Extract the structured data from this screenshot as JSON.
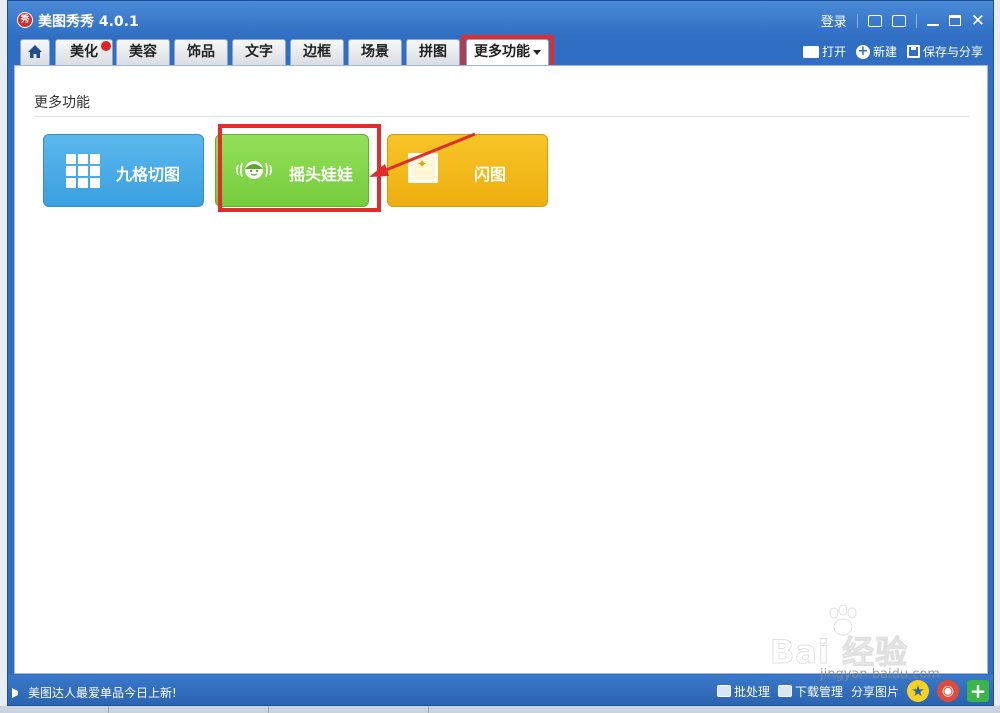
{
  "window": {
    "app_title": "美图秀秀 4.0.1",
    "logo_text": "秀",
    "login_label": "登录"
  },
  "tabs": [
    {
      "label": "美化",
      "badge": true
    },
    {
      "label": "美容"
    },
    {
      "label": "饰品"
    },
    {
      "label": "文字"
    },
    {
      "label": "边框"
    },
    {
      "label": "场景"
    },
    {
      "label": "拼图"
    },
    {
      "label": "更多功能",
      "active": true
    }
  ],
  "toolbar": {
    "open_label": "打开",
    "new_label": "新建",
    "save_share_label": "保存与分享"
  },
  "main": {
    "section_title": "更多功能",
    "features": [
      {
        "label": "九格切图",
        "icon": "grid-icon",
        "color": "#4aabe6"
      },
      {
        "label": "摇头娃娃",
        "icon": "bobblehead-face-icon",
        "color": "#84d64b"
      },
      {
        "label": "闪图",
        "icon": "flash-image-icon",
        "color": "#f2b91a"
      }
    ]
  },
  "status": {
    "message": "美图达人最爱单品今日上新!",
    "batch_label": "批处理",
    "download_label": "下载管理",
    "share_label": "分享图片"
  },
  "watermark": {
    "brand": "Bai 经验",
    "url": "jingyan.baidu.com"
  },
  "colors": {
    "window_blue": "#2f6ec2",
    "highlight_red": "#e12c2c"
  }
}
